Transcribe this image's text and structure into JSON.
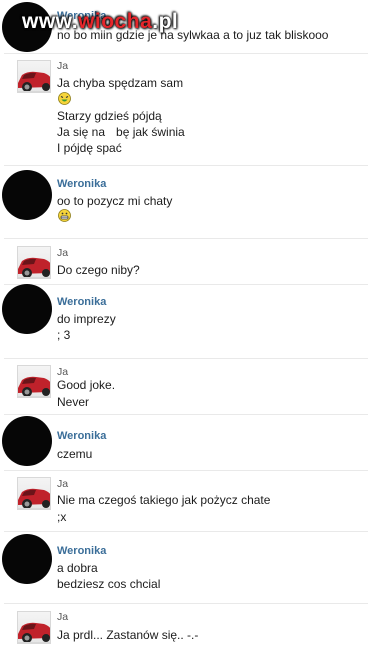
{
  "watermark": {
    "prefix": "www.",
    "accent": "wiocha",
    "suffix": ".pl"
  },
  "messages": [
    {
      "sender": "Weronika",
      "lines": [
        "no bo miin gdzie je na sylwkaa a to juz tak bliskooo"
      ]
    },
    {
      "sender": "Ja",
      "lines": [
        "Ja chyba spędzam sam",
        "Starzy gdzieś pójdą",
        "Ja się na",
        "bę jak świnia",
        "I pójdę spać"
      ],
      "emoticon": "laughing-face-icon"
    },
    {
      "sender": "Weronika",
      "lines": [
        "oo to pozycz mi chaty"
      ],
      "emoticon": "grinning-face-icon"
    },
    {
      "sender": "Ja",
      "lines": [
        "Do czego niby?"
      ]
    },
    {
      "sender": "Weronika",
      "lines": [
        "do imprezy",
        " ; 3"
      ]
    },
    {
      "sender": "Ja",
      "lines": [
        "Good joke.",
        "Never"
      ]
    },
    {
      "sender": "Weronika",
      "lines": [
        "czemu"
      ]
    },
    {
      "sender": "Ja",
      "lines": [
        "Nie ma czegoś takiego jak pożycz chate",
        ";x"
      ]
    },
    {
      "sender": "Weronika",
      "lines": [
        "a dobra",
        " bedziesz cos chcial"
      ]
    },
    {
      "sender": "Ja",
      "lines": [
        "Ja prdl... Zastanów się.. -.-"
      ]
    }
  ],
  "colors": {
    "weronika_name": "#3b6e99",
    "ja_name": "#555555",
    "text": "#1c1c1c",
    "divider": "#e9e9e9",
    "watermark_accent": "#e5262b"
  }
}
